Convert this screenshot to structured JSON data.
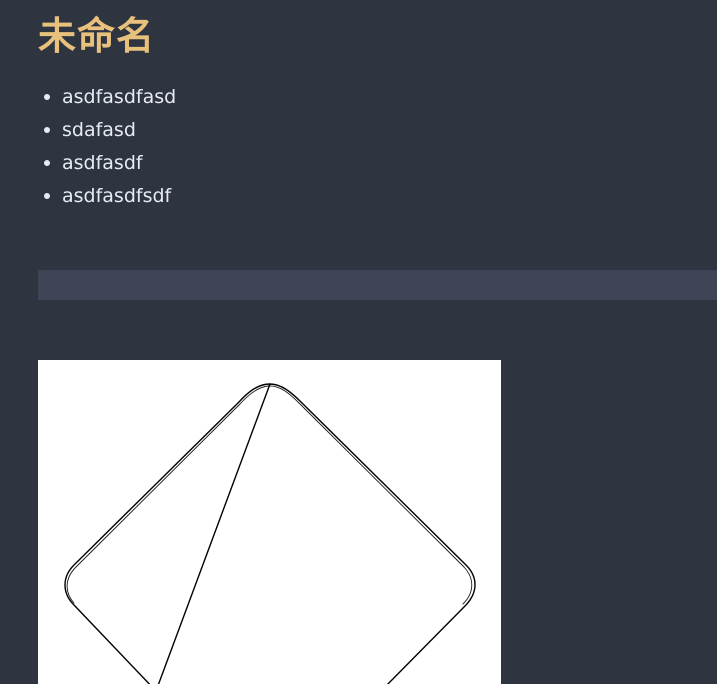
{
  "document": {
    "title": "未命名",
    "bullets": [
      "asdfasdfasd",
      "sdafasd",
      "asdfasdf",
      "asdfasdfsdf"
    ]
  },
  "colors": {
    "background": "#2f3441",
    "title": "#e8c17d",
    "text": "#e7ebf2",
    "divider": "#3f4556",
    "image_background": "#ffffff",
    "stroke": "#000000"
  },
  "image": {
    "shape": "rounded-diamond-sketch"
  }
}
